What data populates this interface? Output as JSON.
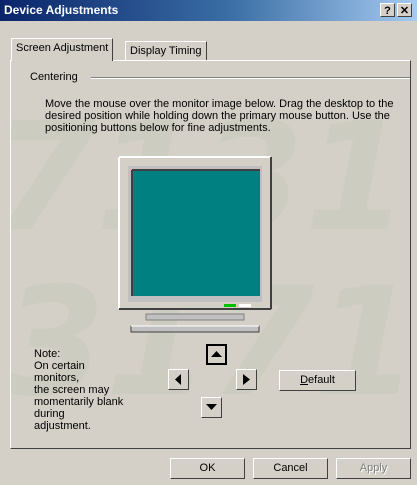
{
  "window": {
    "title": "Device Adjustments",
    "help_label": "?",
    "close_label": "✕"
  },
  "tabs": [
    {
      "label": "Screen Adjustment",
      "active": true
    },
    {
      "label": "Display Timing",
      "active": false
    }
  ],
  "centering": {
    "group_label": "Centering",
    "description": "Move the mouse over the monitor image below. Drag the desktop to the desired position while holding down the primary mouse button. Use the positioning buttons below for fine adjustments.",
    "monitor_screen_color": "#008080",
    "note_lines": [
      "Note:",
      "On certain monitors,",
      "the screen may",
      "momentarily blank",
      "during adjustment."
    ]
  },
  "arrows": {
    "up": "up-arrow-icon",
    "left": "left-arrow-icon",
    "right": "right-arrow-icon",
    "down": "down-arrow-icon"
  },
  "default_button": {
    "accel": "D",
    "rest": "efault"
  },
  "background_deco": {
    "line1": "7131.4",
    "line2": "3171.3"
  },
  "dialog_buttons": {
    "ok": "OK",
    "cancel": "Cancel",
    "apply": "Apply"
  }
}
